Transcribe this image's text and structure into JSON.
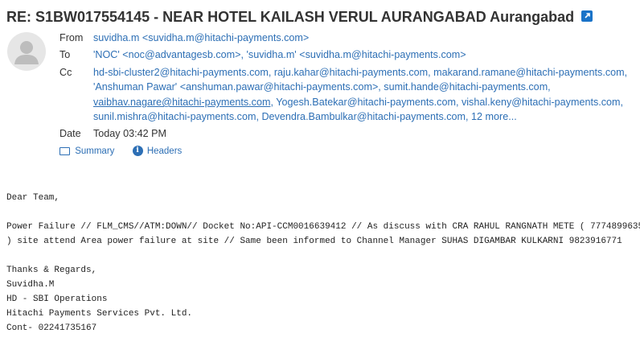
{
  "subject": "RE: S1BW017554145 - NEAR HOTEL KAILASH VERUL AURANGABAD Aurangabad",
  "header": {
    "from_label": "From",
    "from_value": "suvidha.m <suvidha.m@hitachi-payments.com>",
    "to_label": "To",
    "to_value": "'NOC' <noc@advantagesb.com>, 'suvidha.m' <suvidha.m@hitachi-payments.com>",
    "cc_label": "Cc",
    "cc_line1": "hd-sbi-cluster2@hitachi-payments.com, raju.kahar@hitachi-payments.com, makarand.ramane@hitachi-payments.com,",
    "cc_line2": "'Anshuman Pawar' <anshuman.pawar@hitachi-payments.com>, sumit.hande@hitachi-payments.com,",
    "cc_line3_a": "vaibhav.nagare@hitachi-payments.com",
    "cc_line3_b": ", Yogesh.Batekar@hitachi-payments.com, vishal.keny@hitachi-payments.com,",
    "cc_line4": "sunil.mishra@hitachi-payments.com, Devendra.Bambulkar@hitachi-payments.com, 12 more...",
    "date_label": "Date",
    "date_value": "Today 03:42 PM"
  },
  "toggles": {
    "summary": "Summary",
    "headers": "Headers"
  },
  "body": [
    "Dear Team,",
    "",
    "Power Failure // FLM_CMS//ATM:DOWN// Docket No:API-CCM0016639412 // As discuss with CRA RAHUL RANGNATH METE ( 7774899635",
    ") site attend Area power failure at site // Same been informed to Channel Manager SUHAS DIGAMBAR KULKARNI 9823916771",
    "",
    "Thanks & Regards,",
    "Suvidha.M",
    "HD - SBI Operations",
    "Hitachi Payments Services Pvt. Ltd.",
    "Cont- 02241735167"
  ],
  "icons": {
    "open_external": "external-link-icon",
    "avatar": "user-avatar-icon",
    "summary": "envelope-icon",
    "headers": "info-icon"
  },
  "colors": {
    "link": "#2d6fb5",
    "icon_blue": "#1a73c8",
    "avatar_bg": "#e6e6e6"
  }
}
